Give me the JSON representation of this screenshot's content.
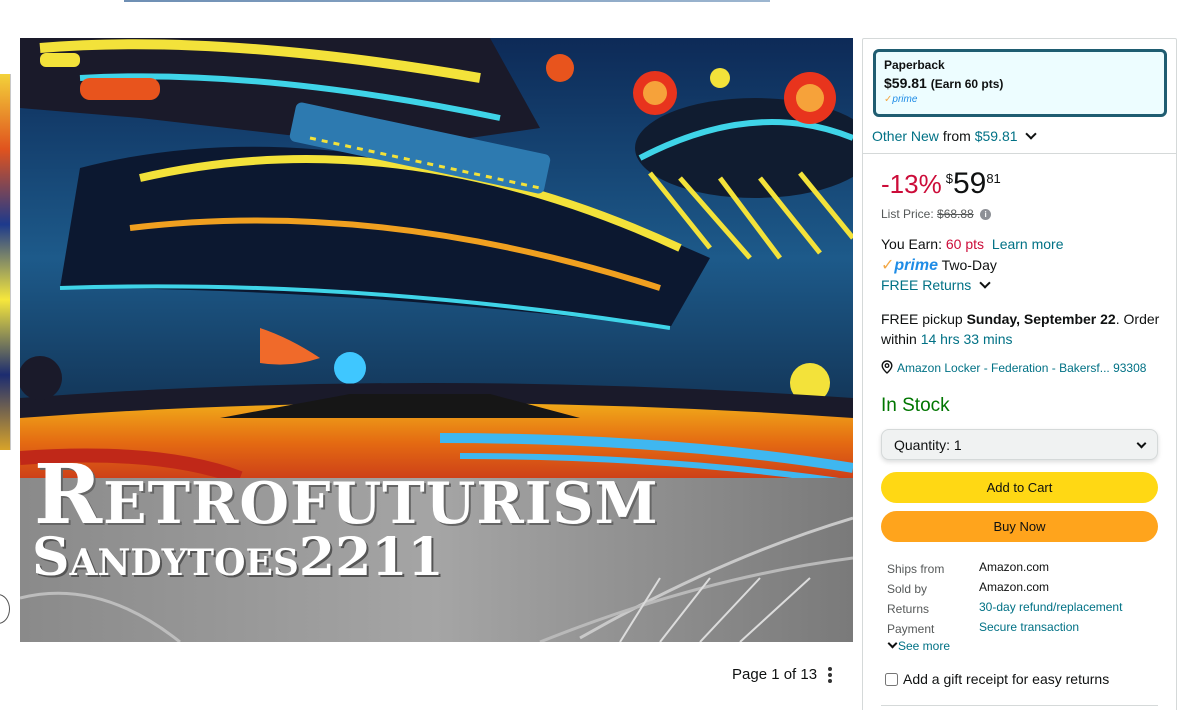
{
  "product_image": {
    "title": "Retrofuturism",
    "subtitle": "Sandytoes2211"
  },
  "pager": {
    "text": "Page 1 of 13"
  },
  "buybox": {
    "format": {
      "name": "Paperback",
      "price": "$59.81",
      "points": "(Earn 60 pts)",
      "prime": "prime"
    },
    "other_new": {
      "label": "Other New",
      "from": "from",
      "price": "$59.81"
    },
    "price": {
      "discount": "-13%",
      "currency": "$",
      "whole": "59",
      "fraction": "81"
    },
    "list_price": {
      "label": "List Price:",
      "value": "$68.88"
    },
    "earn": {
      "label": "You Earn:",
      "points": "60 pts",
      "learn_more": "Learn more"
    },
    "prime": {
      "logo": "prime",
      "speed": "Two-Day"
    },
    "free_returns": "FREE Returns",
    "pickup": {
      "prefix": "FREE pickup",
      "date": "Sunday, September 22",
      "order_within": ". Order within",
      "countdown": "14 hrs 33 mins"
    },
    "locker": "Amazon Locker - Federation - Bakersf... 93308",
    "stock": "In Stock",
    "quantity": {
      "label": "Quantity:",
      "value": "1"
    },
    "add_to_cart": "Add to Cart",
    "buy_now": "Buy Now",
    "details": {
      "ships_from_label": "Ships from",
      "ships_from": "Amazon.com",
      "sold_by_label": "Sold by",
      "sold_by": "Amazon.com",
      "returns_label": "Returns",
      "returns": "30-day refund/replacement",
      "payment_label": "Payment",
      "payment": "Secure transaction"
    },
    "see_more": "See more",
    "gift_receipt": "Add a gift receipt for easy returns"
  },
  "colors": {
    "link": "#007185",
    "deal_red": "#cc0c39",
    "in_stock": "#007600",
    "add_to_cart": "#ffd814",
    "buy_now": "#ffa41c",
    "prime_blue": "#1f8ce6"
  }
}
